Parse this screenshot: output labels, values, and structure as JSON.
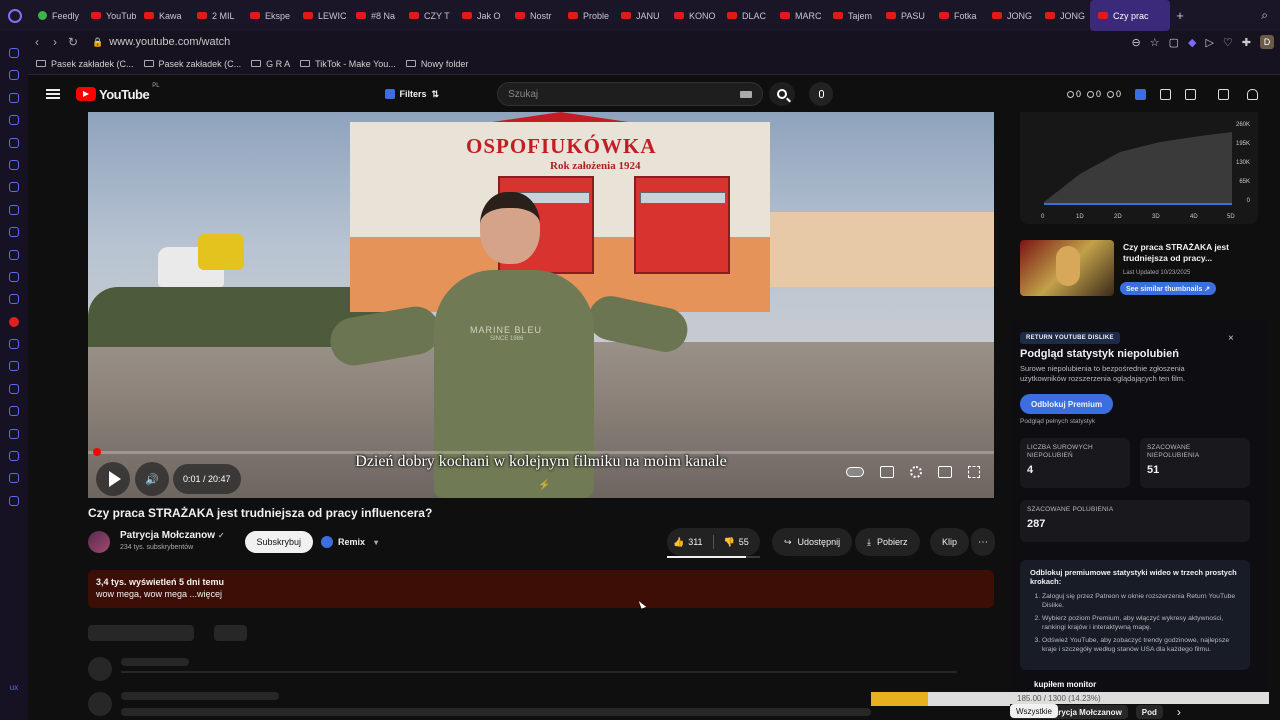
{
  "browser": {
    "tabs": [
      {
        "label": "Feedly",
        "favicon": "feedly-icon"
      },
      {
        "label": "YouTube",
        "favicon": "youtube-icon"
      },
      {
        "label": "Kawa",
        "favicon": "youtube-icon"
      },
      {
        "label": "2 MIL",
        "favicon": "youtube-icon"
      },
      {
        "label": "Ekspe",
        "favicon": "youtube-icon"
      },
      {
        "label": "LEWIC",
        "favicon": "youtube-icon"
      },
      {
        "label": "#8 Na",
        "favicon": "youtube-icon"
      },
      {
        "label": "CZY T",
        "favicon": "youtube-icon"
      },
      {
        "label": "Jak O",
        "favicon": "youtube-icon"
      },
      {
        "label": "Nostr",
        "favicon": "youtube-icon"
      },
      {
        "label": "Proble",
        "favicon": "youtube-icon"
      },
      {
        "label": "JANU",
        "favicon": "youtube-icon"
      },
      {
        "label": "KONO",
        "favicon": "youtube-icon"
      },
      {
        "label": "DLAC",
        "favicon": "youtube-icon"
      },
      {
        "label": "MARC",
        "favicon": "youtube-icon"
      },
      {
        "label": "Tajem",
        "favicon": "youtube-icon"
      },
      {
        "label": "PASU",
        "favicon": "youtube-icon"
      },
      {
        "label": "Fotka",
        "favicon": "youtube-icon"
      },
      {
        "label": "JONG",
        "favicon": "youtube-icon"
      },
      {
        "label": "JONG",
        "favicon": "youtube-icon"
      }
    ],
    "active_tab": "Czy prac",
    "new_tab": "+",
    "url": "www.youtube.com/watch",
    "bookmarks": [
      "Pasek zakładek (C...",
      "Pasek zakładek (C...",
      "G R A",
      "TikTok - Make You...",
      "Nowy folder"
    ],
    "profile_initial": "D",
    "left_rail_text": "ux"
  },
  "youtube": {
    "logo_text": "YouTube",
    "country": "PL",
    "filters_label": "Filters",
    "search_placeholder": "Szukaj",
    "counters": [
      "0",
      "0",
      "0"
    ]
  },
  "player": {
    "sign_main": "OSPOFIUKÓWKA",
    "sign_sub": "Rok założenia 1924",
    "shirt_text": "MARINE BLEU",
    "shirt_sub": "SINCE 1986",
    "caption": "Dzień dobry kochani w kolejnym filmiku na moim kanale",
    "time": "0:01 / 20:47",
    "progress_fraction": 0.0008
  },
  "video": {
    "title": "Czy praca STRAŻAKA jest trudniejsza od pracy influencera?",
    "channel": "Patrycja Mołczanow",
    "verified": "✓",
    "subscribers": "234 tys. subskrybentów",
    "subscribe_label": "Subskrybuj",
    "remix_label": "Remix",
    "likes": "311",
    "dislikes": "55",
    "like_ratio": 0.85,
    "share_label": "Udostępnij",
    "download_label": "Pobierz",
    "clip_label": "Klip",
    "more_label": "⋯",
    "description_stats": "3,4 tys. wyświetleń  5 dni temu",
    "description_text": "wow mega, wow mega ...więcej"
  },
  "sidebar": {
    "graph": {
      "y_ticks": [
        "260K",
        "195K",
        "130K",
        "65K",
        "0"
      ],
      "x_ticks": [
        "0",
        "1D",
        "2D",
        "3D",
        "4D",
        "5D"
      ]
    },
    "similar": {
      "title": "Czy praca STRAŻAKA jest trudniejsza od pracy...",
      "updated": "Last Updated 10/23/2025",
      "button": "See similar thumbnails ↗"
    },
    "ryd": {
      "badge": "RETURN YOUTUBE DISLIKE",
      "close": "×",
      "title": "Podgląd statystyk niepolubień",
      "description": "Surowe niepolubienia to bezpośrednie zgłoszenia użytkowników rozszerzenia oglądających ten film.",
      "unlock_button": "Odblokuj Premium",
      "full_stats": "Podgląd pełnych statystyk",
      "stats": [
        {
          "label": "LICZBA SUROWYCH NIEPOLUBIEŃ",
          "value": "4"
        },
        {
          "label": "SZACOWANE NIEPOLUBIENIA",
          "value": "51"
        },
        {
          "label": "SZACOWANE POLUBIENIA",
          "value": "287"
        }
      ],
      "premium_heading": "Odblokuj premiumowe statystyki wideo w trzech prostych krokach:",
      "steps": [
        "Zaloguj się przez Patreon w oknie rozszerzenia Return YouTube Dislike.",
        "Wybierz poziom Premium, aby włączyć wykresy aktywności, rankingi krajów i interaktywną mapę.",
        "Odśwież YouTube, aby zobaczyć trendy godzinowe, najlepsze kraje i szczegóły według stanów USA dla każdego filmu."
      ]
    },
    "toast": "kupiłem monitor",
    "progress_text": "185.00 / 1300 (14.23%)",
    "progress_fraction": 0.1423,
    "chips": [
      "Wszystkie",
      "Źródło: Patrycja Mołczanow",
      "Pod"
    ],
    "chip_next": "›"
  },
  "colors": {
    "accent": "#3b6fe0",
    "youtube_red": "#ff0000",
    "description_bg": "#3d0e05"
  }
}
